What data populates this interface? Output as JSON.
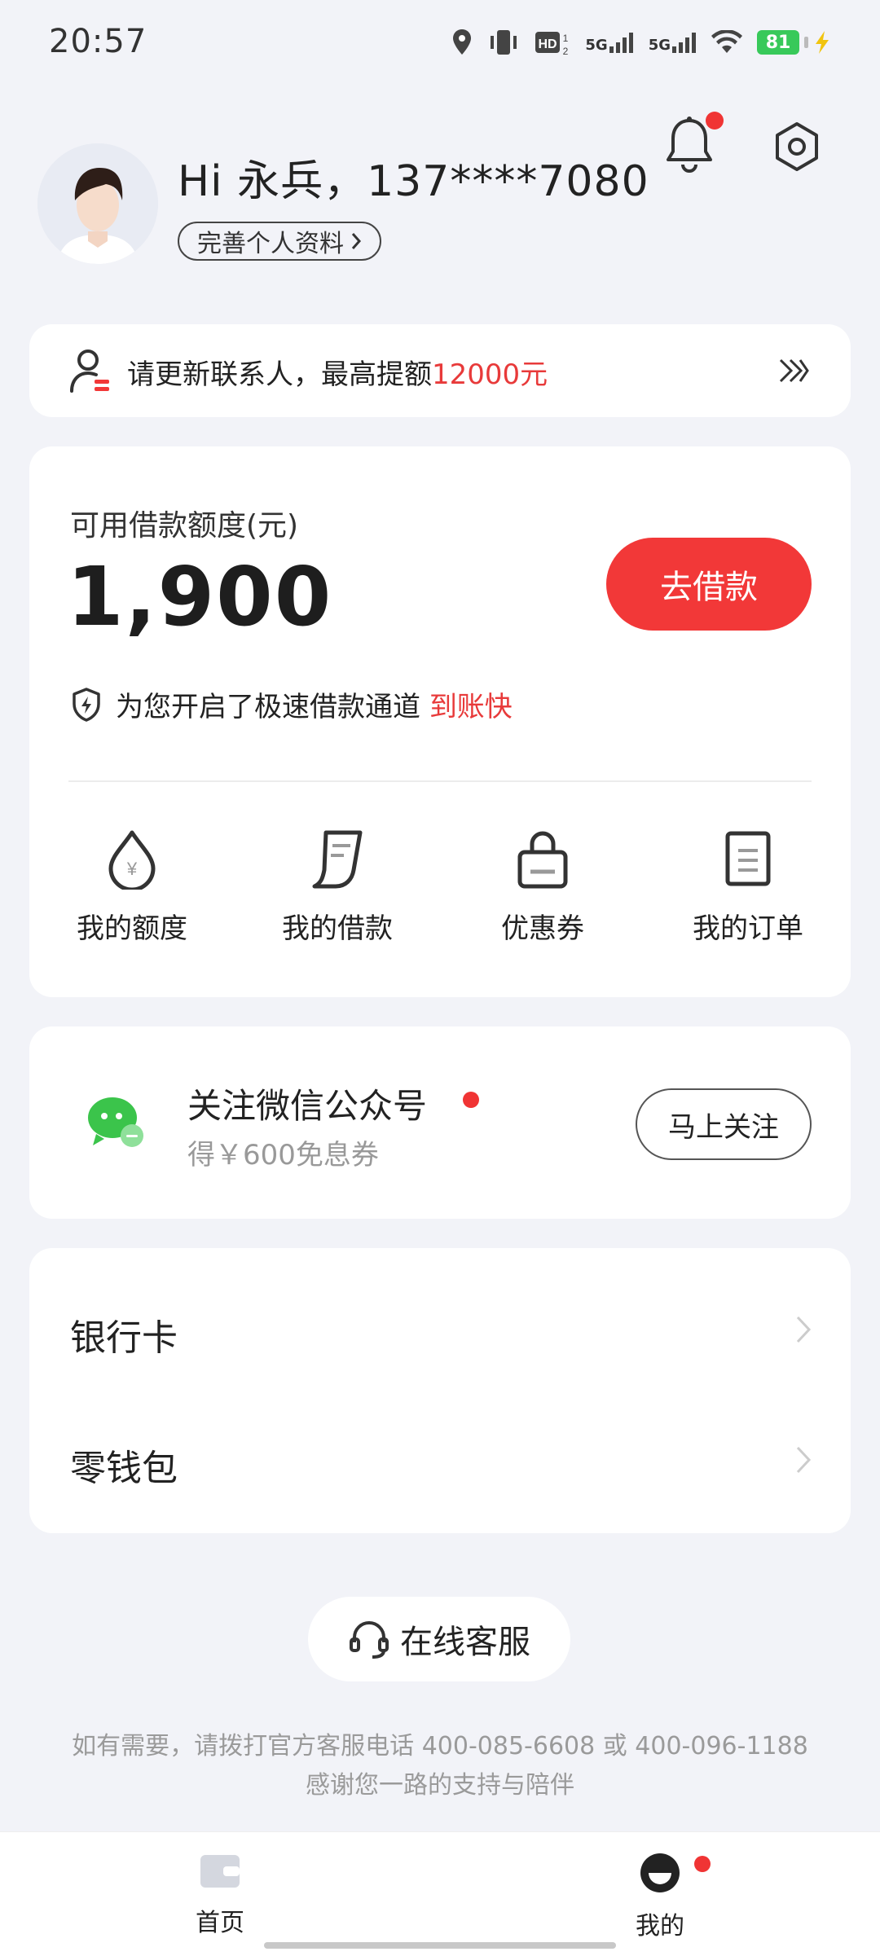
{
  "status_bar": {
    "time": "20:57",
    "battery": "81",
    "network_a": "5G",
    "network_b": "5G"
  },
  "profile": {
    "greeting": "Hi 永兵，137****7080",
    "complete_label": "完善个人资料"
  },
  "notice": {
    "text": "请更新联系人，最高提额",
    "highlight": "12000元"
  },
  "loan": {
    "label": "可用借款额度(元)",
    "amount": "1,900",
    "button": "去借款",
    "fast_text": "为您开启了极速借款通道",
    "fast_highlight": "到账快",
    "menu": [
      {
        "label": "我的额度",
        "icon": "yen-drop-icon"
      },
      {
        "label": "我的借款",
        "icon": "receipt-icon"
      },
      {
        "label": "优惠券",
        "icon": "coupon-bag-icon"
      },
      {
        "label": "我的订单",
        "icon": "order-doc-icon"
      }
    ]
  },
  "wechat": {
    "title": "关注微信公众号",
    "subtitle": "得￥600免息券",
    "button": "马上关注"
  },
  "list": [
    {
      "label": "银行卡"
    },
    {
      "label": "零钱包"
    }
  ],
  "service": {
    "label": "在线客服"
  },
  "footer": {
    "line1": "如有需要，请拨打官方客服电话 400-085-6608 或 400-096-1188",
    "line2": "感谢您一路的支持与陪伴"
  },
  "tabs": [
    {
      "label": "首页"
    },
    {
      "label": "我的"
    }
  ],
  "colors": {
    "accent": "#f23838",
    "background": "#f2f3f8",
    "wechat_green": "#3bc44b"
  }
}
